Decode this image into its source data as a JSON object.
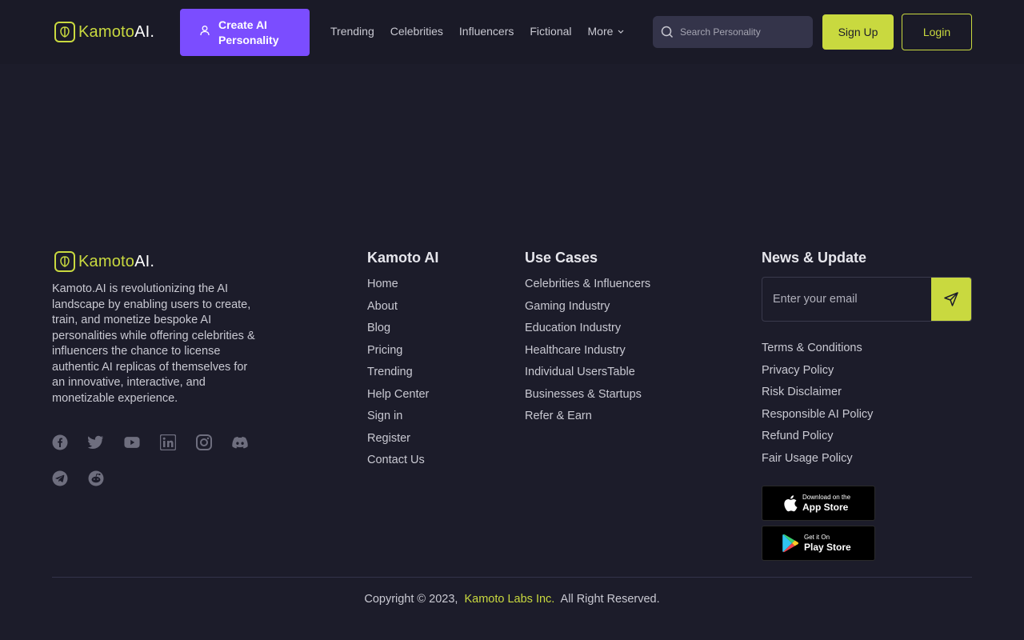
{
  "brand": {
    "name_part1": "Kamoto",
    "name_part2": "AI.",
    "accent": "#c9d93f",
    "primary": "#7b4dff"
  },
  "header": {
    "create_label": "Create AI Personality",
    "nav": [
      {
        "label": "Trending"
      },
      {
        "label": "Celebrities"
      },
      {
        "label": "Influencers"
      },
      {
        "label": "Fictional"
      },
      {
        "label": "More",
        "icon": "chevron-down-icon"
      }
    ],
    "search_placeholder": "Search Personality",
    "signup_label": "Sign Up",
    "login_label": "Login"
  },
  "footer": {
    "about": "Kamoto.AI is revolutionizing the AI landscape by enabling users to create, train, and monetize bespoke AI personalities while offering celebrities & influencers the chance to license authentic AI replicas of themselves for an innovative, interactive, and monetizable experience.",
    "socials": [
      "facebook-icon",
      "twitter-icon",
      "youtube-icon",
      "linkedin-icon",
      "instagram-icon",
      "discord-icon",
      "telegram-icon",
      "reddit-icon"
    ],
    "col1": {
      "title": "Kamoto AI",
      "items": [
        "Home",
        "About",
        "Blog",
        "Pricing",
        "Trending",
        "Help Center",
        "Sign in",
        "Register",
        "Contact Us"
      ]
    },
    "col2": {
      "title": "Use Cases",
      "items": [
        "Celebrities & Influencers",
        "Gaming Industry",
        "Education Industry",
        "Healthcare Industry",
        "Individual UsersTable",
        "Businesses & Startups",
        "Refer & Earn"
      ]
    },
    "col3": {
      "title": "News & Update",
      "email_placeholder": "Enter your email",
      "items": [
        "Terms & Conditions",
        "Privacy Policy",
        "Risk Disclaimer",
        "Responsible AI Policy",
        "Refund Policy",
        "Fair Usage Policy"
      ]
    },
    "app_store": {
      "small": "Download on the",
      "big": "App Store"
    },
    "play_store": {
      "small": "Get it On",
      "big": "Play Store"
    },
    "copyright_prefix": "Copyright © 2023,",
    "copyright_company": "Kamoto Labs Inc.",
    "copyright_suffix": "All Right Reserved."
  }
}
